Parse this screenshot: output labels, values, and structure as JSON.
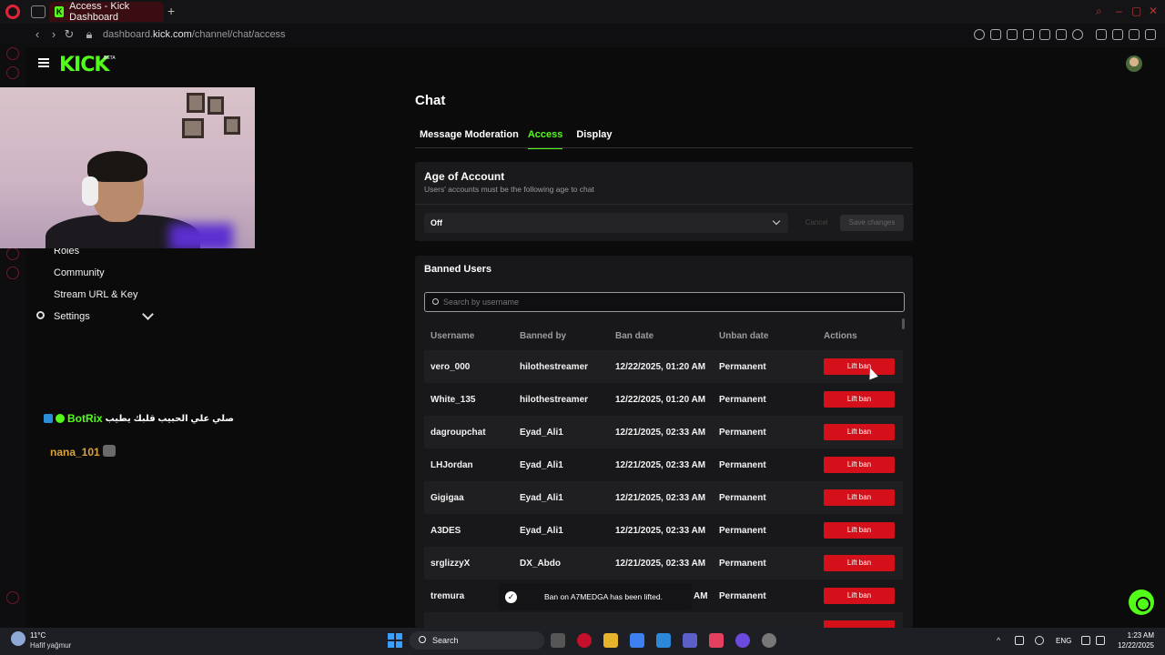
{
  "browser": {
    "tab_title": "Access - Kick Dashboard",
    "tab_favicon_letter": "K",
    "new_tab": "+",
    "url_prefix": "dashboard.",
    "url_host": "kick.com",
    "url_path": "/channel/chat/access"
  },
  "header": {
    "logo": "KICK",
    "logo_badge": "BETA"
  },
  "sidebar": {
    "items": [
      {
        "label": "Roles"
      },
      {
        "label": "Community"
      },
      {
        "label": "Stream URL & Key"
      },
      {
        "label": "Settings"
      }
    ]
  },
  "chat_overlay": {
    "bot_name": "BotRix",
    "bot_message": "صلي علي الحبيب قلبك يطيب",
    "user_name": "nana_101"
  },
  "page": {
    "title": "Chat",
    "tabs": [
      {
        "label": "Message Moderation",
        "active": false
      },
      {
        "label": "Access",
        "active": true
      },
      {
        "label": "Display",
        "active": false
      }
    ]
  },
  "age_of_account": {
    "title": "Age of Account",
    "subtitle": "Users' accounts must be the following age to chat",
    "selected": "Off",
    "cancel_label": "Cancel",
    "save_label": "Save changes"
  },
  "banned_users": {
    "title": "Banned Users",
    "search_placeholder": "Search by username",
    "columns": [
      "Username",
      "Banned by",
      "Ban date",
      "Unban date",
      "Actions"
    ],
    "action_label": "Lift ban",
    "rows": [
      {
        "username": "vero_000",
        "banned_by": "hilothestreamer",
        "ban_date": "12/22/2025, 01:20 AM",
        "unban_date": "Permanent"
      },
      {
        "username": "White_135",
        "banned_by": "hilothestreamer",
        "ban_date": "12/22/2025, 01:20 AM",
        "unban_date": "Permanent"
      },
      {
        "username": "dagroupchat",
        "banned_by": "Eyad_Ali1",
        "ban_date": "12/21/2025, 02:33 AM",
        "unban_date": "Permanent"
      },
      {
        "username": "LHJordan",
        "banned_by": "Eyad_Ali1",
        "ban_date": "12/21/2025, 02:33 AM",
        "unban_date": "Permanent"
      },
      {
        "username": "Gigigaa",
        "banned_by": "Eyad_Ali1",
        "ban_date": "12/21/2025, 02:33 AM",
        "unban_date": "Permanent"
      },
      {
        "username": "A3DES",
        "banned_by": "Eyad_Ali1",
        "ban_date": "12/21/2025, 02:33 AM",
        "unban_date": "Permanent"
      },
      {
        "username": "srglizzyX",
        "banned_by": "DX_Abdo",
        "ban_date": "12/21/2025, 02:33 AM",
        "unban_date": "Permanent"
      },
      {
        "username": "tremura",
        "banned_by": "",
        "ban_date": "AM",
        "unban_date": "Permanent"
      }
    ]
  },
  "toast": {
    "message": "Ban on A7MEDGA has been lifted."
  },
  "taskbar": {
    "weather_temp": "11°C",
    "weather_desc": "Hafif yağmur",
    "search_label": "Search",
    "language": "ENG",
    "time": "1:23 AM",
    "date": "12/22/2025"
  },
  "colors": {
    "accent": "#53fc18",
    "danger": "#d4101a",
    "background": "#0b0b0c",
    "card": "#18181a"
  }
}
